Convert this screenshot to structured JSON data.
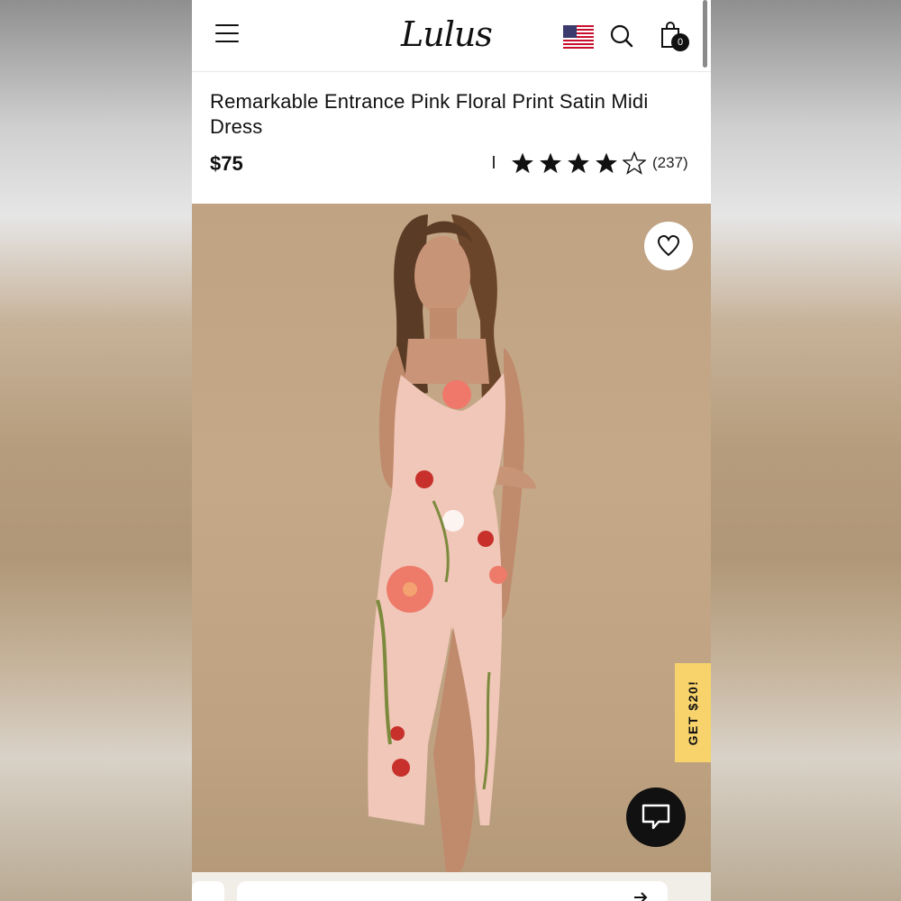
{
  "header": {
    "brand": "Lulus",
    "bag_count": "0"
  },
  "product": {
    "title": "Remarkable Entrance Pink Floral Print Satin Midi Dress",
    "price": "$75",
    "rating": 4,
    "rating_max": 5,
    "review_count": "(237)"
  },
  "promo": {
    "label": "GET $20!"
  },
  "colors": {
    "accent_yellow": "#f8d36b",
    "hero_background": "#c4a888",
    "text": "#111111"
  },
  "icons": [
    "menu-icon",
    "us-flag-icon",
    "search-icon",
    "shopping-bag-icon",
    "heart-icon",
    "chat-icon",
    "arrow-right-icon"
  ]
}
